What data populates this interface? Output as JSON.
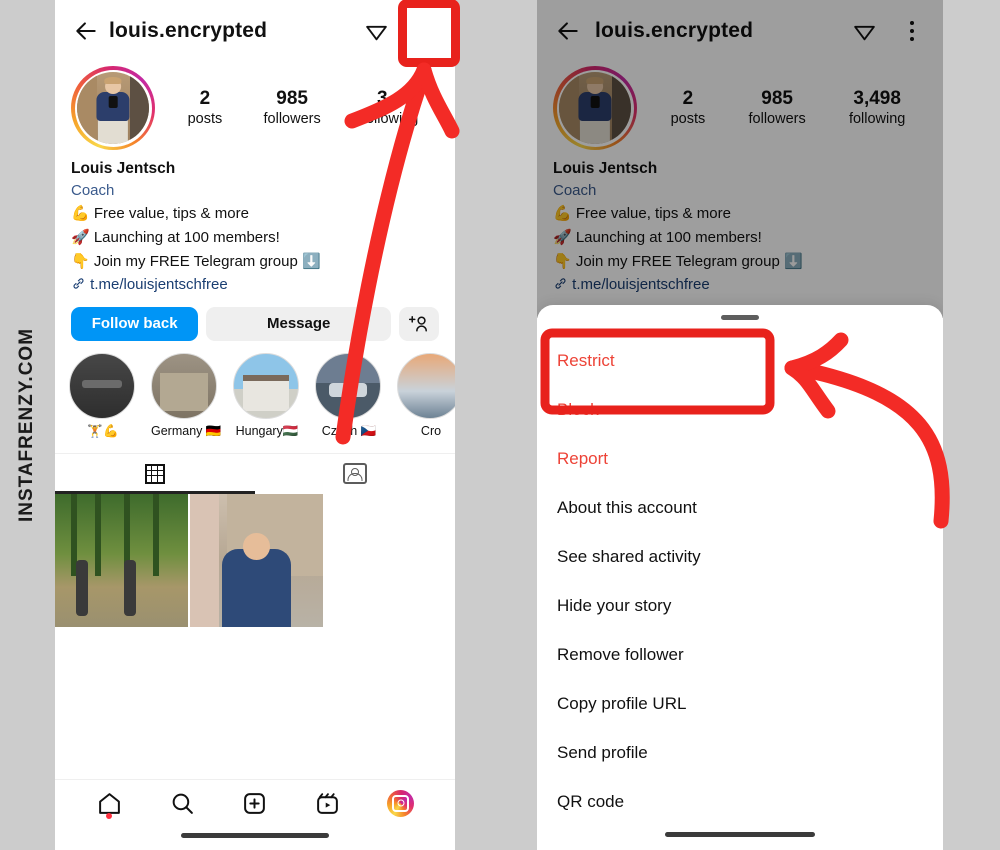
{
  "watermark": {
    "text": "INSTAFRENZY.COM"
  },
  "colors": {
    "accent_red": "#e8221c",
    "instagram_blue": "#0095f6",
    "danger": "#ed4337",
    "background": "#cccccc"
  },
  "profile": {
    "username": "louis.encrypted",
    "display_name": "Louis Jentsch",
    "category": "Coach",
    "bio": [
      "💪 Free value, tips & more",
      "🚀 Launching at 100 members!",
      "👇 Join my FREE Telegram group ⬇️"
    ],
    "link": "t.me/louisjentschfree",
    "stats": [
      {
        "number": "2",
        "label": "posts"
      },
      {
        "number": "985",
        "label": "followers"
      },
      {
        "number": "3,498",
        "label": "following"
      }
    ],
    "stats_left": [
      {
        "number": "2",
        "label": "posts"
      },
      {
        "number": "985",
        "label": "followers"
      },
      {
        "number": "3,4",
        "label": "following"
      }
    ],
    "buttons": {
      "follow": "Follow back",
      "message": "Message",
      "add_user_icon": "add-user-icon"
    },
    "highlights": [
      {
        "label": "🏋️💪"
      },
      {
        "label": "Germany 🇩🇪"
      },
      {
        "label": "Hungary🇭🇺"
      },
      {
        "label": "Czech 🇨🇿"
      },
      {
        "label": "Cro"
      }
    ],
    "tabs": [
      {
        "icon": "grid-icon",
        "active": true
      },
      {
        "icon": "tagged-icon",
        "active": false
      }
    ]
  },
  "appbar": {
    "back_icon": "back-arrow-icon",
    "share_icon": "paper-plane-icon",
    "more_icon": "more-options-icon"
  },
  "bottom_nav": [
    {
      "icon": "home-icon",
      "badge": true
    },
    {
      "icon": "search-icon",
      "badge": false
    },
    {
      "icon": "create-post-icon",
      "badge": false
    },
    {
      "icon": "reels-icon",
      "badge": false
    },
    {
      "icon": "profile-avatar-icon",
      "badge": false
    }
  ],
  "sheet": {
    "handle": "drag-handle",
    "items": [
      {
        "label": "Restrict",
        "style": "danger"
      },
      {
        "label": "Block",
        "style": "danger"
      },
      {
        "label": "Report",
        "style": "danger"
      },
      {
        "label": "About this account",
        "style": "normal"
      },
      {
        "label": "See shared activity",
        "style": "normal"
      },
      {
        "label": "Hide your story",
        "style": "normal"
      },
      {
        "label": "Remove follower",
        "style": "normal"
      },
      {
        "label": "Copy profile URL",
        "style": "normal"
      },
      {
        "label": "Send profile",
        "style": "normal"
      },
      {
        "label": "QR code",
        "style": "normal"
      }
    ]
  },
  "annotations": {
    "highlight_menu_button": "more-options-icon",
    "highlight_menu_item": "Restrict",
    "arrow_up": "straight-arrow-pointing-up",
    "arrow_curved": "curved-arrow-pointing-left"
  }
}
